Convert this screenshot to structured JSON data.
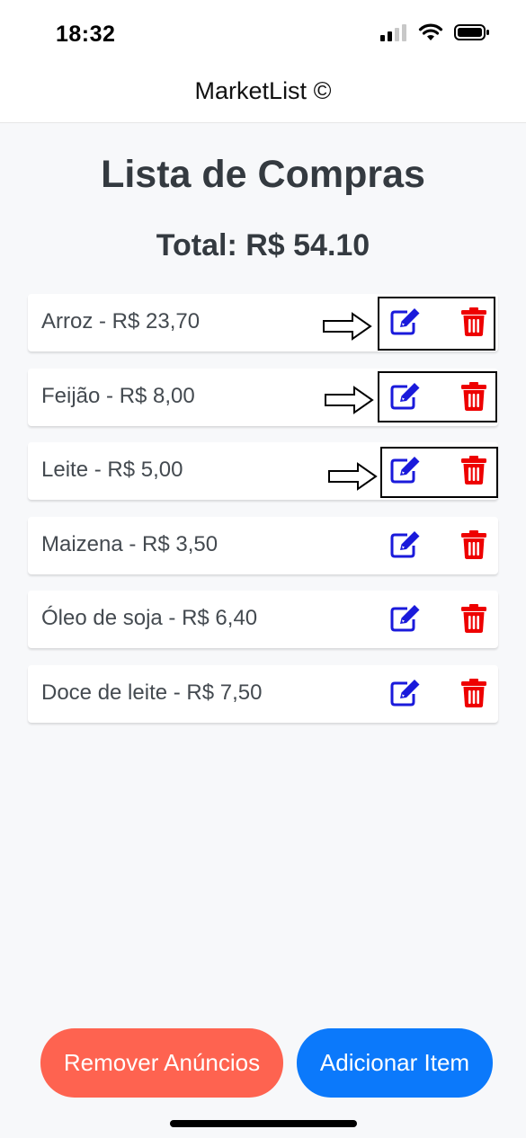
{
  "status_bar": {
    "time": "18:32",
    "icons": [
      "signal-icon",
      "wifi-icon",
      "battery-icon"
    ]
  },
  "header": {
    "title": "MarketList ©"
  },
  "main": {
    "title": "Lista de Compras",
    "total": "Total: R$ 54.10",
    "items": [
      {
        "label": "Arroz - R$ 23,70"
      },
      {
        "label": "Feijão - R$ 8,00"
      },
      {
        "label": "Leite - R$ 5,00"
      },
      {
        "label": "Maizena - R$ 3,50"
      },
      {
        "label": "Óleo de soja - R$ 6,40"
      },
      {
        "label": "Doce de leite - R$ 7,50"
      }
    ]
  },
  "actions": {
    "remove_ads": "Remover Anúncios",
    "add_item": "Adicionar Item"
  },
  "colors": {
    "edit_icon": "#1a1adb",
    "delete_icon": "#ee0000",
    "remove_button": "#fe6350",
    "add_button": "#0b79fb"
  }
}
